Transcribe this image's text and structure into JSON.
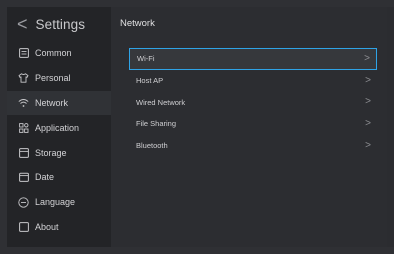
{
  "sidebar": {
    "back_glyph": "<",
    "title": "Settings",
    "items": [
      {
        "label": "Common",
        "icon": "list-icon",
        "active": false
      },
      {
        "label": "Personal",
        "icon": "shirt-icon",
        "active": false
      },
      {
        "label": "Network",
        "icon": "wifi-icon",
        "active": true
      },
      {
        "label": "Application",
        "icon": "apps-icon",
        "active": false
      },
      {
        "label": "Storage",
        "icon": "storage-icon",
        "active": false
      },
      {
        "label": "Date",
        "icon": "calendar-icon",
        "active": false
      },
      {
        "label": "Language",
        "icon": "globe-icon",
        "active": false
      },
      {
        "label": "About",
        "icon": "info-icon",
        "active": false
      }
    ]
  },
  "main": {
    "title": "Network",
    "items": [
      {
        "label": "Wi-Fi",
        "chevron": ">"
      },
      {
        "label": "Host AP",
        "chevron": ">"
      },
      {
        "label": "Wired Network",
        "chevron": ">"
      },
      {
        "label": "File Sharing",
        "chevron": ">"
      },
      {
        "label": "Bluetooth",
        "chevron": ">"
      }
    ],
    "focused_index": 0
  },
  "colors": {
    "focus_border": "#2fa3e6",
    "sidebar_bg": "#232427",
    "main_bg": "#2c2d31"
  }
}
